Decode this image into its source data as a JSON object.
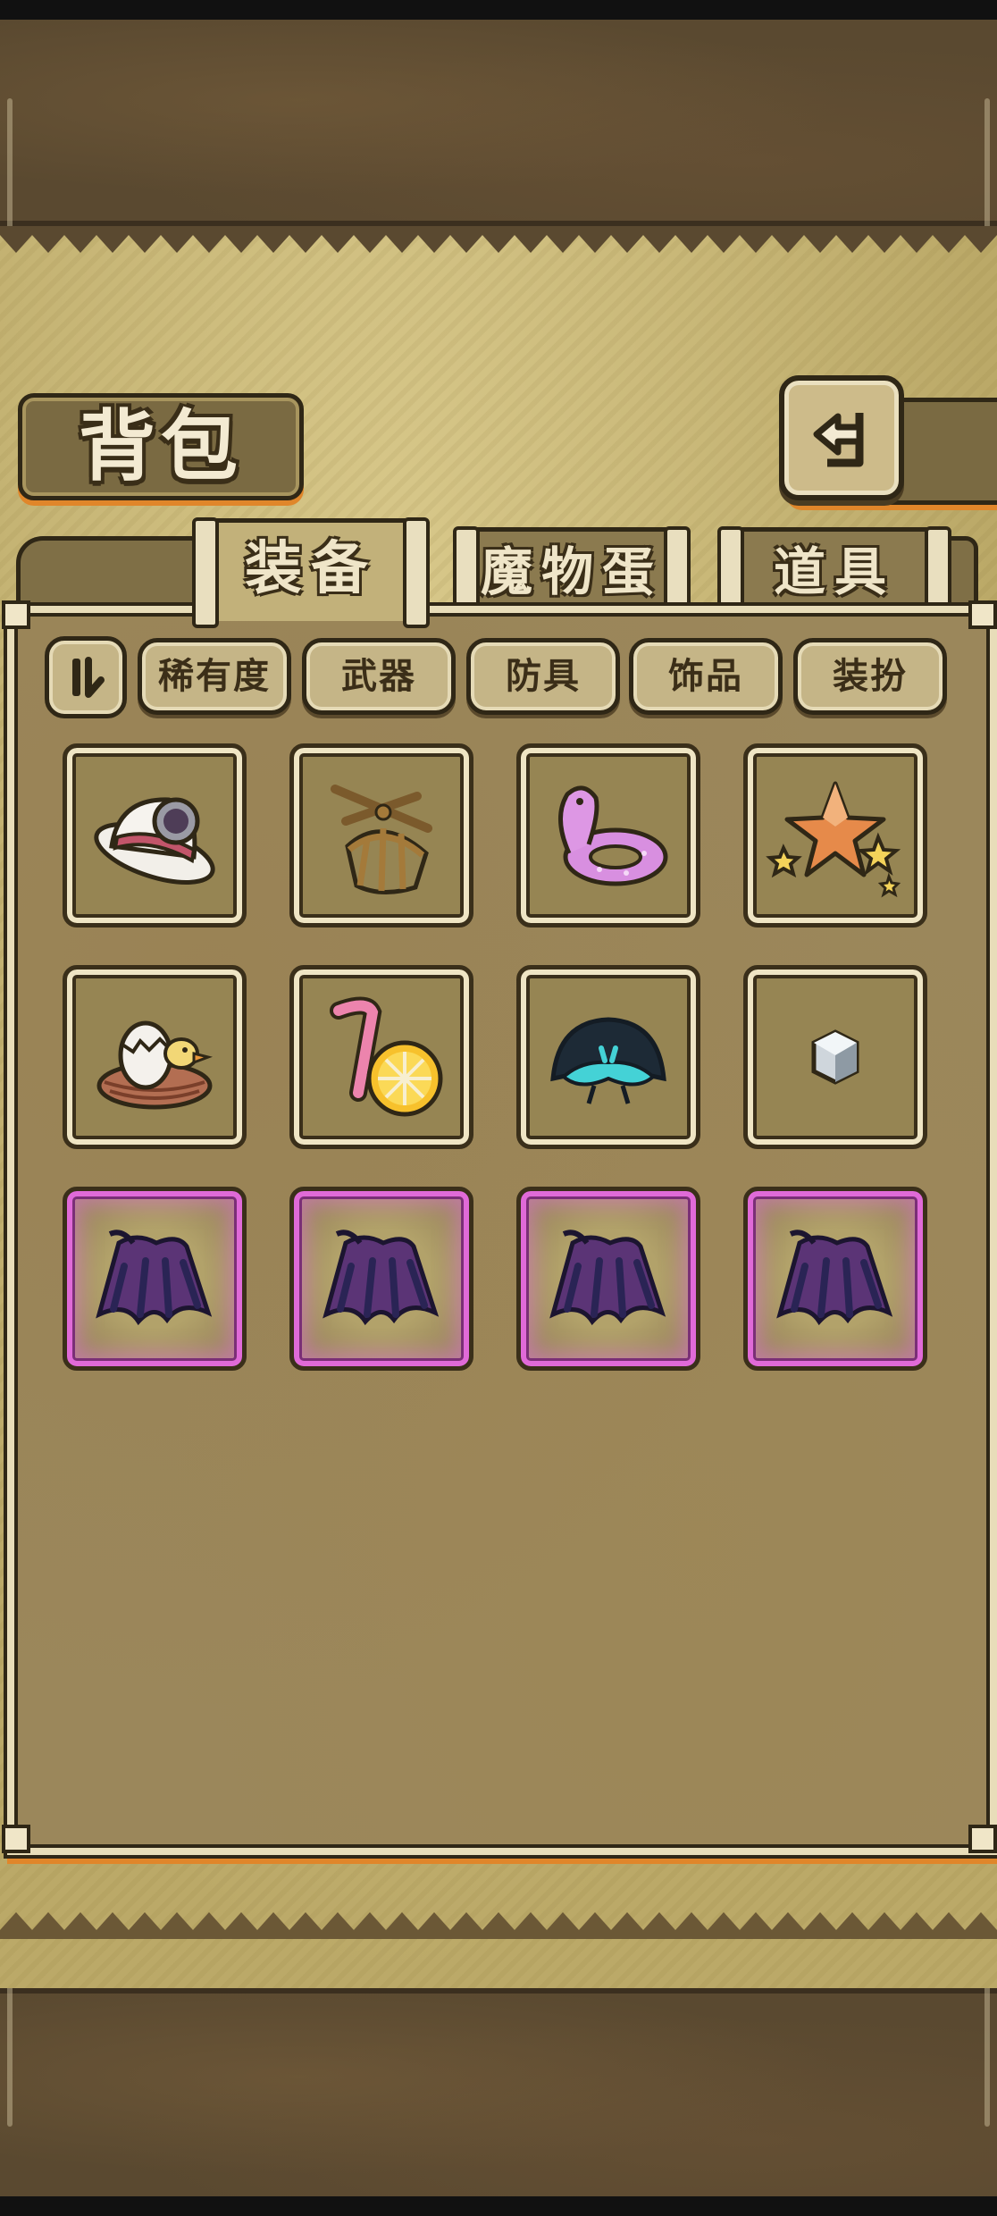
{
  "page": {
    "title": "背包",
    "back_icon": "return-arrow-icon"
  },
  "tabs": [
    {
      "label": "装备",
      "active": true
    },
    {
      "label": "魔物蛋",
      "active": false
    },
    {
      "label": "道具",
      "active": false
    }
  ],
  "filters": {
    "sort_icon": "sort-toggle-icon",
    "buttons": [
      "稀有度",
      "武器",
      "防具",
      "饰品",
      "装扮"
    ]
  },
  "items": [
    {
      "icon": "white-hat-with-lens-icon",
      "rarity": "normal"
    },
    {
      "icon": "wooden-propeller-basket-icon",
      "rarity": "normal"
    },
    {
      "icon": "pink-swim-ring-icon",
      "rarity": "normal"
    },
    {
      "icon": "star-hairpin-icon",
      "rarity": "normal"
    },
    {
      "icon": "egg-nest-duckling-icon",
      "rarity": "normal"
    },
    {
      "icon": "straw-and-orange-slice-icon",
      "rarity": "normal"
    },
    {
      "icon": "dark-mustache-creature-icon",
      "rarity": "normal"
    },
    {
      "icon": "silver-gem-icon",
      "rarity": "normal"
    },
    {
      "icon": "purple-feather-cloak-icon",
      "rarity": "epic"
    },
    {
      "icon": "purple-feather-cloak-icon",
      "rarity": "epic"
    },
    {
      "icon": "purple-feather-cloak-icon",
      "rarity": "epic"
    },
    {
      "icon": "purple-feather-cloak-icon",
      "rarity": "epic"
    }
  ],
  "colors": {
    "parchment": "#c7b574",
    "panel": "#9b875b",
    "outline": "#2f2716",
    "accent_orange": "#e0862a",
    "epic_frame": "#e06ad8"
  }
}
